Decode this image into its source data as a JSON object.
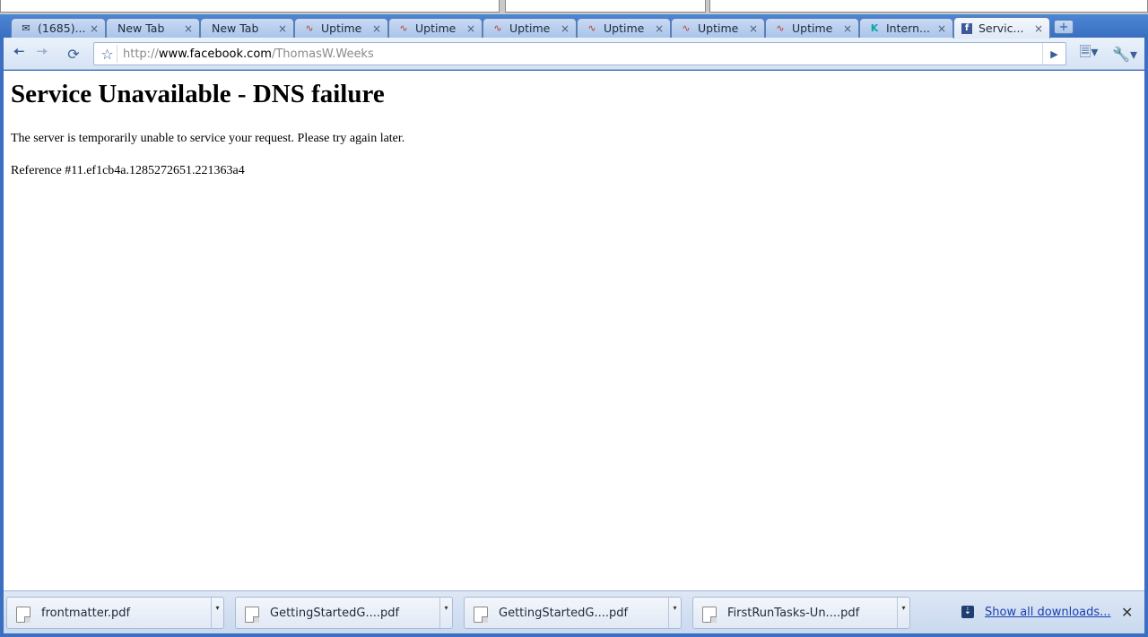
{
  "tabs": [
    {
      "title": "(1685)...",
      "icon": "mail-icon"
    },
    {
      "title": "New Tab",
      "icon": ""
    },
    {
      "title": "New Tab",
      "icon": ""
    },
    {
      "title": "Uptime",
      "icon": "chart-icon"
    },
    {
      "title": "Uptime",
      "icon": "chart-icon"
    },
    {
      "title": "Uptime",
      "icon": "chart-icon"
    },
    {
      "title": "Uptime",
      "icon": "chart-icon"
    },
    {
      "title": "Uptime",
      "icon": "chart-icon"
    },
    {
      "title": "Uptime",
      "icon": "chart-icon"
    },
    {
      "title": "Intern...",
      "icon": "k-icon"
    },
    {
      "title": "Servic...",
      "icon": "facebook-icon",
      "active": true
    }
  ],
  "omnibox": {
    "scheme": "http://",
    "host": "www.facebook.com",
    "path": "/ThomasW.Weeks"
  },
  "page": {
    "heading": "Service Unavailable - DNS failure",
    "message": "The server is temporarily unable to service your request. Please try again later.",
    "reference": "Reference #11.ef1cb4a.1285272651.221363a4"
  },
  "downloads": [
    {
      "filename": "frontmatter.pdf"
    },
    {
      "filename": "GettingStartedG....pdf"
    },
    {
      "filename": "GettingStartedG....pdf"
    },
    {
      "filename": "FirstRunTasks-Un....pdf"
    }
  ],
  "shelf": {
    "show_all_label": "Show all downloads..."
  },
  "colors": {
    "frame": "#3b6fc2",
    "link": "#1a3fb0"
  }
}
